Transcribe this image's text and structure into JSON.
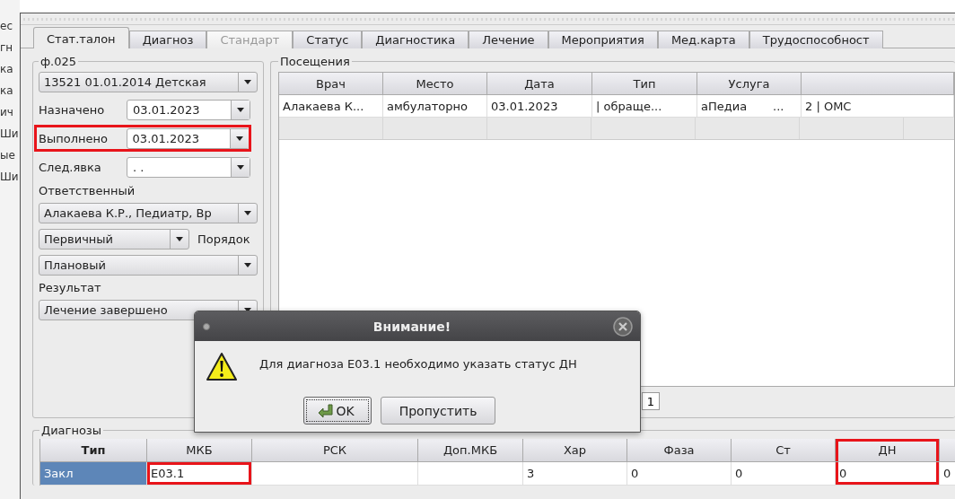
{
  "background_window": {
    "fragments": [
      "ес",
      "гн",
      "ка",
      "ка",
      "ич",
      "Ши",
      "ые",
      "Ши"
    ]
  },
  "tabs": [
    {
      "label": "Стат.талон",
      "selected": true,
      "disabled": false
    },
    {
      "label": "Диагноз",
      "selected": false,
      "disabled": false
    },
    {
      "label": "Стандарт",
      "selected": false,
      "disabled": true
    },
    {
      "label": "Статус",
      "selected": false,
      "disabled": false
    },
    {
      "label": "Диагностика",
      "selected": false,
      "disabled": false
    },
    {
      "label": "Лечение",
      "selected": false,
      "disabled": false
    },
    {
      "label": "Мероприятия",
      "selected": false,
      "disabled": false
    },
    {
      "label": "Мед.карта",
      "selected": false,
      "disabled": false
    },
    {
      "label": "Трудоспособност",
      "selected": false,
      "disabled": false
    }
  ],
  "form_025": {
    "title": "ф.025",
    "card_combo": "13521 01.01.2014 Детская",
    "date_fields": [
      {
        "label": "Назначено",
        "value": "03.01.2023",
        "highlighted": false
      },
      {
        "label": "Выполнено",
        "value": "03.01.2023",
        "highlighted": true
      },
      {
        "label": "След.явка",
        "value": ". .",
        "highlighted": false
      }
    ],
    "responsible_label": "Ответственный",
    "responsible": "Алакаева К.Р., Педиатр, Вр",
    "visit_kind": "Первичный",
    "order_label": "Порядок",
    "order": "Плановый",
    "result_label": "Результат",
    "result": "Лечение завершено"
  },
  "visits": {
    "title": "Посещения",
    "columns": [
      "Врач",
      "Место",
      "Дата",
      "Тип",
      "Услуга"
    ],
    "rows": [
      [
        "Алакаева К...",
        "амбулаторно",
        "03.01.2023",
        "| обраще...",
        "аПедиа       ...",
        "2 | ОМС"
      ]
    ],
    "pager": "1"
  },
  "dialog": {
    "title": "Внимание!",
    "message": "Для диагноза E03.1 необходимо указать статус ДН",
    "buttons": [
      {
        "label": "OK",
        "default": true
      },
      {
        "label": "Пропустить",
        "default": false
      }
    ]
  },
  "diagnoses": {
    "title": "Диагнозы",
    "columns": [
      {
        "label": "Тип",
        "highlighted": false
      },
      {
        "label": "МКБ",
        "highlighted": false
      },
      {
        "label": "РСК",
        "highlighted": false
      },
      {
        "label": "Доп.МКБ",
        "highlighted": false
      },
      {
        "label": "Хар",
        "highlighted": false
      },
      {
        "label": "Фаза",
        "highlighted": false
      },
      {
        "label": "Ст",
        "highlighted": false
      },
      {
        "label": "ДН",
        "highlighted": true
      }
    ],
    "rows": [
      {
        "selected": true,
        "cells": [
          {
            "text": "Закл",
            "highlighted": false
          },
          {
            "text": "E03.1",
            "highlighted": true
          },
          null,
          null,
          {
            "text": "3",
            "highlighted": false
          },
          {
            "text": "0",
            "highlighted": false
          },
          {
            "text": "0",
            "highlighted": false
          },
          {
            "text": "0",
            "highlighted": false
          },
          {
            "text": "0",
            "highlighted": false
          }
        ]
      }
    ]
  }
}
